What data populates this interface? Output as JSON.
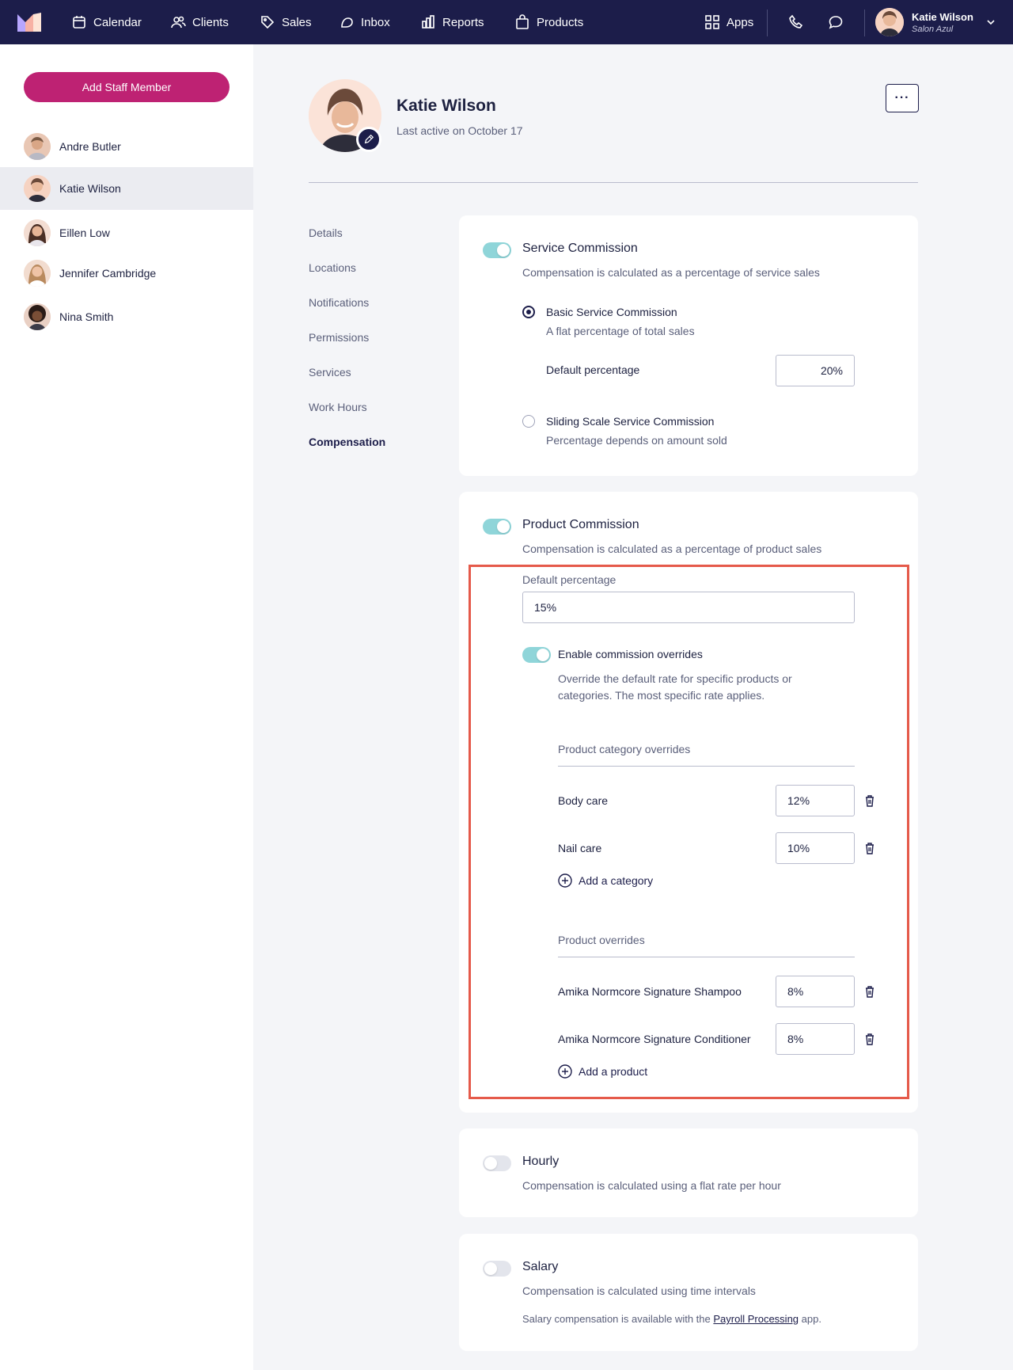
{
  "nav": {
    "items": [
      {
        "label": "Calendar",
        "icon": "calendar-icon"
      },
      {
        "label": "Clients",
        "icon": "clients-icon"
      },
      {
        "label": "Sales",
        "icon": "tag-icon"
      },
      {
        "label": "Inbox",
        "icon": "inbox-icon"
      },
      {
        "label": "Reports",
        "icon": "reports-icon"
      },
      {
        "label": "Products",
        "icon": "bag-icon"
      }
    ],
    "apps_label": "Apps",
    "user_name": "Katie Wilson",
    "user_sub": "Salon Azul"
  },
  "sidebar": {
    "add_button": "Add Staff Member",
    "staff": [
      {
        "name": "Andre Butler"
      },
      {
        "name": "Katie Wilson"
      },
      {
        "name": "Eillen Low"
      },
      {
        "name": "Jennifer Cambridge"
      },
      {
        "name": "Nina Smith"
      }
    ]
  },
  "profile": {
    "name": "Katie Wilson",
    "last_active": "Last active on October 17",
    "more_label": "···"
  },
  "sections": [
    "Details",
    "Locations",
    "Notifications",
    "Permissions",
    "Services",
    "Work Hours",
    "Compensation"
  ],
  "service": {
    "title": "Service Commission",
    "desc": "Compensation is calculated as a percentage of service sales",
    "basic_title": "Basic Service Commission",
    "basic_desc": "A flat percentage of total sales",
    "default_label": "Default percentage",
    "default_value": "20%",
    "sliding_title": "Sliding Scale Service Commission",
    "sliding_desc": "Percentage depends on amount sold"
  },
  "product": {
    "title": "Product Commission",
    "desc": "Compensation is calculated as a percentage of product sales",
    "default_label": "Default percentage",
    "default_value": "15%",
    "override_title": "Enable commission overrides",
    "override_desc1": "Override the default rate for specific products or",
    "override_desc2": "categories. The most specific rate applies.",
    "category_heading": "Product category overrides",
    "categories": [
      {
        "name": "Body care",
        "value": "12%"
      },
      {
        "name": "Nail care",
        "value": "10%"
      }
    ],
    "add_category": "Add a category",
    "product_heading": "Product overrides",
    "products": [
      {
        "name": "Amika Normcore Signature Shampoo",
        "value": "8%"
      },
      {
        "name": "Amika Normcore Signature Conditioner",
        "value": "8%"
      }
    ],
    "add_product": "Add a product"
  },
  "hourly": {
    "title": "Hourly",
    "desc": "Compensation is calculated using a flat rate per hour"
  },
  "salary": {
    "title": "Salary",
    "desc": "Compensation is calculated using time intervals",
    "note_prefix": "Salary compensation is available with the",
    "note_link": "Payroll Processing",
    "note_suffix": "app."
  },
  "colors": {
    "nav_bg": "#1c1d4a",
    "primary_button": "#be2273",
    "toggle_on": "#8fd5d9",
    "highlight": "#e55a4a"
  }
}
